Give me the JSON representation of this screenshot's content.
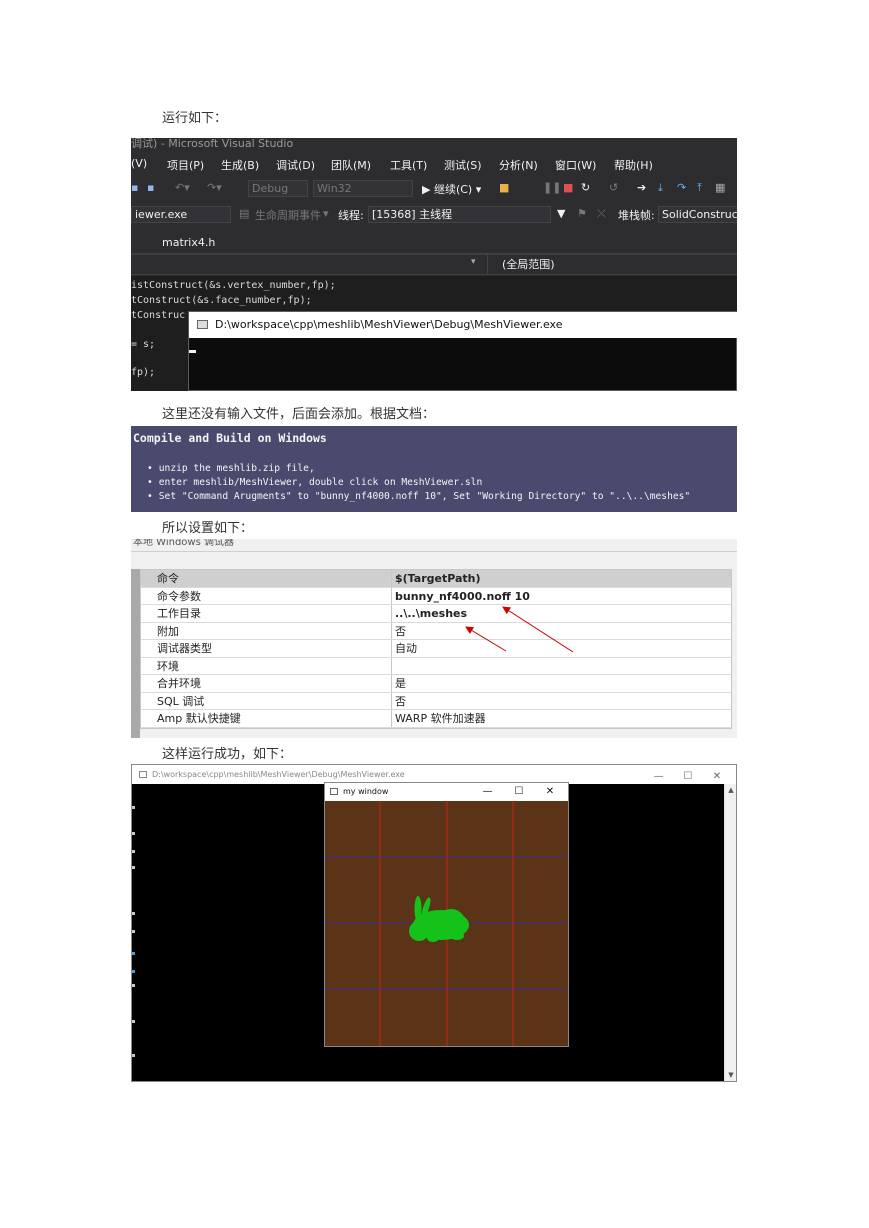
{
  "paragraphs": {
    "p1": "运行如下：",
    "p2": "这里还没有输入文件，后面会添加。根据文档：",
    "p3": "所以设置如下：",
    "p4": "这样运行成功，如下："
  },
  "vs": {
    "title": "调试) - Microsoft Visual Studio",
    "menu": [
      "(V)",
      "项目(P)",
      "生成(B)",
      "调试(D)",
      "团队(M)",
      "工具(T)",
      "测试(S)",
      "分析(N)",
      "窗口(W)",
      "帮助(H)"
    ],
    "config": "Debug",
    "platform": "Win32",
    "continue_label": "▶ 继续(C) ▾",
    "process": "iewer.exe",
    "lifecycle_label": "生命周期事件",
    "thread_label": "线程:",
    "thread_value": "[15368] 主线程",
    "stack_label": "堆栈帧:",
    "stack_value": "SolidConstruct",
    "tab": "matrix4.h",
    "scope": "(全局范围)",
    "code": [
      "istConstruct(&s.vertex_number,fp);",
      "tConstruct(&s.face_number,fp);",
      "tConstruc",
      "= s;",
      "fp);"
    ],
    "console_title": "D:\\workspace\\cpp\\meshlib\\MeshViewer\\Debug\\MeshViewer.exe"
  },
  "doc": {
    "title": "Compile and Build on Windows",
    "items": [
      "unzip the meshlib.zip file,",
      "enter meshlib/MeshViewer, double click on MeshViewer.sln",
      "Set \"Command Arugments\" to \"bunny_nf4000.noff 10\", Set \"Working Directory\" to \"..\\..\\meshes\""
    ]
  },
  "props": {
    "header": "本地 Windows 调试器",
    "rows": [
      {
        "k": "命令",
        "v": "$(TargetPath)",
        "bold": true,
        "header": true
      },
      {
        "k": "命令参数",
        "v": "bunny_nf4000.noff 10",
        "bold": true
      },
      {
        "k": "工作目录",
        "v": "..\\..\\meshes",
        "bold": true
      },
      {
        "k": "附加",
        "v": "否"
      },
      {
        "k": "调试器类型",
        "v": "自动"
      },
      {
        "k": "环境",
        "v": ""
      },
      {
        "k": "合并环境",
        "v": "是"
      },
      {
        "k": "SQL 调试",
        "v": "否"
      },
      {
        "k": "Amp 默认快捷键",
        "v": "WARP 软件加速器"
      }
    ],
    "arrow_color": "#cc0000"
  },
  "run": {
    "title": "D:\\workspace\\cpp\\meshlib\\MeshViewer\\Debug\\MeshViewer.exe",
    "mywin_title": "my window",
    "colors": {
      "viewport_bg": "#5b3317",
      "grid_vertical": "#e0201c",
      "grid_horizontal": "#3a2bb8",
      "bunny": "#15c21a"
    }
  }
}
